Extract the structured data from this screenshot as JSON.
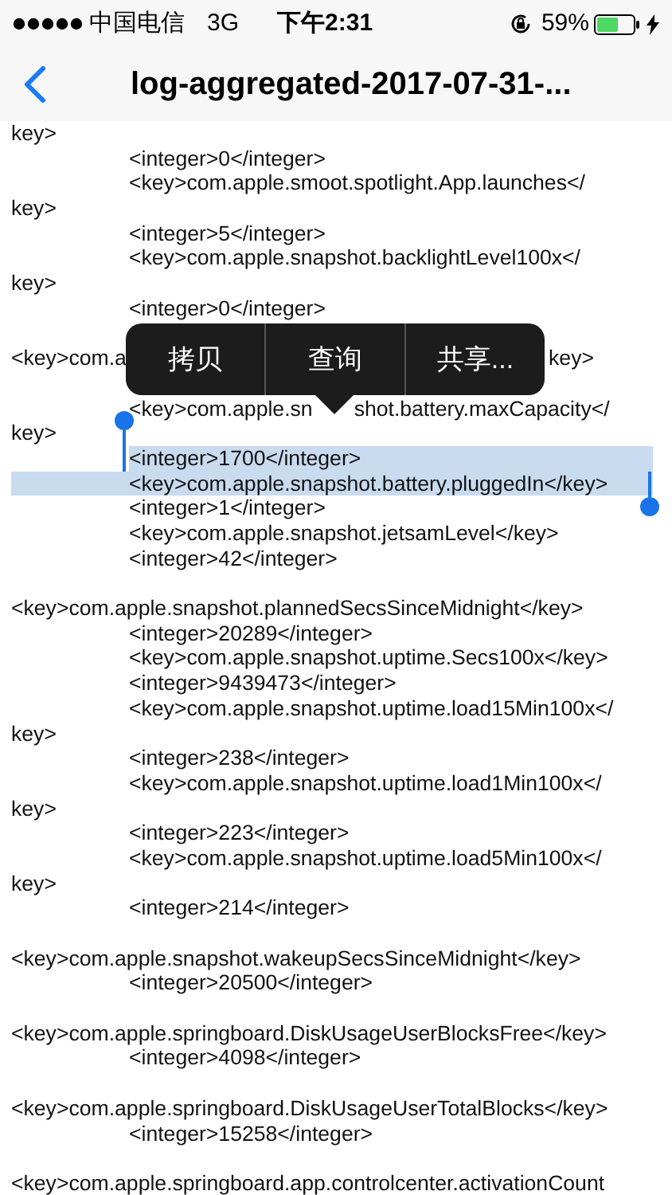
{
  "status_bar": {
    "carrier": "中国电信",
    "network": "3G",
    "time": "下午2:31",
    "battery_percent": "59%"
  },
  "nav": {
    "title": "log-aggregated-2017-07-31-..."
  },
  "lines": [
    {
      "kind": "flush",
      "text": "key>"
    },
    {
      "kind": "indented",
      "text": "<integer>0</integer>"
    },
    {
      "kind": "indented",
      "text": "<key>com.apple.smoot.spotlight.App.launches</"
    },
    {
      "kind": "flush",
      "text": "key>"
    },
    {
      "kind": "indented",
      "text": "<integer>5</integer>"
    },
    {
      "kind": "indented",
      "text": "<key>com.apple.snapshot.backlightLevel100x</"
    },
    {
      "kind": "flush",
      "text": "key>"
    },
    {
      "kind": "indented",
      "text": "<integer>0</integer>"
    },
    {
      "kind": "gap"
    },
    {
      "kind": "covered",
      "left": "<key>com.a",
      "right": "key>"
    },
    {
      "kind": "gap"
    },
    {
      "kind": "covered_indented",
      "left": "<key>com.apple.sn",
      "right": "shot.battery.maxCapacity</"
    },
    {
      "kind": "flush",
      "text": "key>"
    },
    {
      "kind": "indented",
      "text": "<integer>1700</integer>",
      "selected": true
    },
    {
      "kind": "indented",
      "text": "<key>com.apple.snapshot.battery.pluggedIn</key>",
      "selected": true
    },
    {
      "kind": "indented",
      "text": "<integer>1</integer>"
    },
    {
      "kind": "indented",
      "text": "<key>com.apple.snapshot.jetsamLevel</key>"
    },
    {
      "kind": "indented",
      "text": "<integer>42</integer>"
    },
    {
      "kind": "gap"
    },
    {
      "kind": "flush",
      "text": "<key>com.apple.snapshot.plannedSecsSinceMidnight</key>"
    },
    {
      "kind": "indented",
      "text": "<integer>20289</integer>"
    },
    {
      "kind": "indented",
      "text": "<key>com.apple.snapshot.uptime.Secs100x</key>"
    },
    {
      "kind": "indented",
      "text": "<integer>9439473</integer>"
    },
    {
      "kind": "indented",
      "text": "<key>com.apple.snapshot.uptime.load15Min100x</"
    },
    {
      "kind": "flush",
      "text": "key>"
    },
    {
      "kind": "indented",
      "text": "<integer>238</integer>"
    },
    {
      "kind": "indented",
      "text": "<key>com.apple.snapshot.uptime.load1Min100x</"
    },
    {
      "kind": "flush",
      "text": "key>"
    },
    {
      "kind": "indented",
      "text": "<integer>223</integer>"
    },
    {
      "kind": "indented",
      "text": "<key>com.apple.snapshot.uptime.load5Min100x</"
    },
    {
      "kind": "flush",
      "text": "key>"
    },
    {
      "kind": "indented",
      "text": "<integer>214</integer>"
    },
    {
      "kind": "gap"
    },
    {
      "kind": "flush",
      "text": "<key>com.apple.snapshot.wakeupSecsSinceMidnight</key>"
    },
    {
      "kind": "indented",
      "text": "<integer>20500</integer>"
    },
    {
      "kind": "gap"
    },
    {
      "kind": "flush",
      "text": "<key>com.apple.springboard.DiskUsageUserBlocksFree</key>"
    },
    {
      "kind": "indented",
      "text": "<integer>4098</integer>"
    },
    {
      "kind": "gap"
    },
    {
      "kind": "flush",
      "text": "<key>com.apple.springboard.DiskUsageUserTotalBlocks</key>"
    },
    {
      "kind": "indented",
      "text": "<integer>15258</integer>"
    },
    {
      "kind": "gap"
    },
    {
      "kind": "flush",
      "text": "<key>com.apple.springboard.app.controlcenter.activationCount"
    }
  ],
  "edit_menu": [
    "拷贝",
    "查询",
    "共享..."
  ]
}
